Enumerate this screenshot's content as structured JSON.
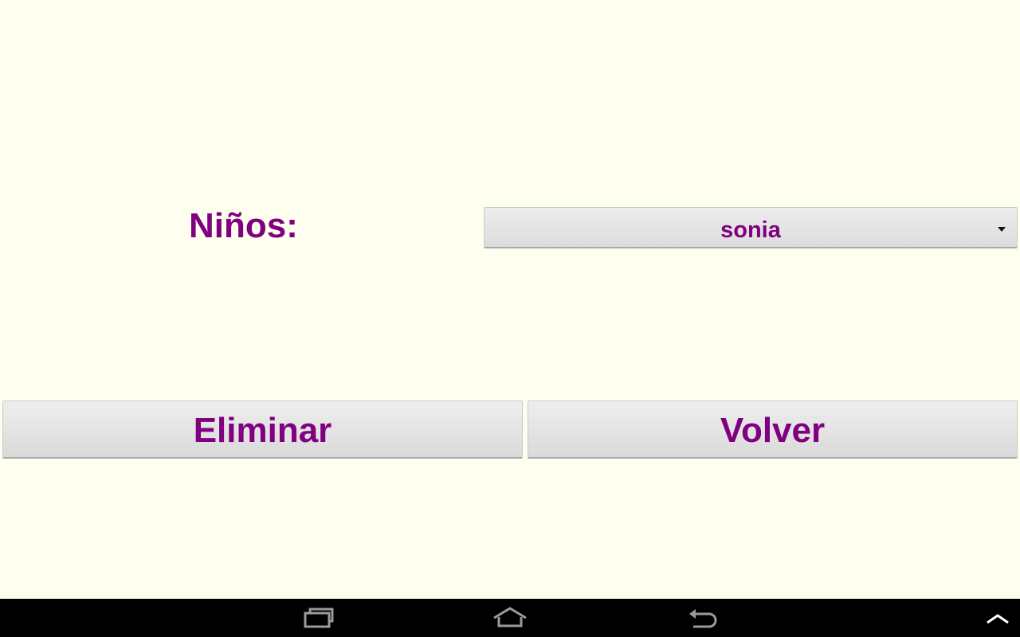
{
  "form": {
    "ninos_label": "Niños:",
    "ninos_selected": "sonia"
  },
  "actions": {
    "eliminar_label": "Eliminar",
    "volver_label": "Volver"
  },
  "navbar": {
    "icons": [
      "recent-apps-icon",
      "home-icon",
      "back-icon",
      "chevron-up-icon"
    ]
  },
  "colors": {
    "background": "#fffff0",
    "text_accent": "#800080",
    "navbar": "#000000"
  }
}
